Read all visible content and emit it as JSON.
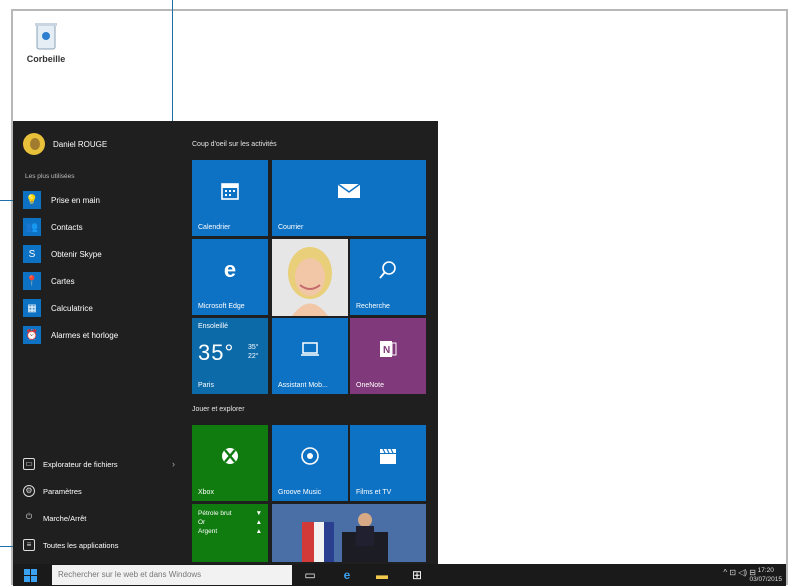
{
  "desktop": {
    "recycle_bin_label": "Corbeille"
  },
  "start_menu": {
    "user_name": "Daniel ROUGE",
    "most_used_label": "Les plus utilisées",
    "apps": [
      {
        "label": "Prise en main",
        "icon": "lightbulb-icon"
      },
      {
        "label": "Contacts",
        "icon": "people-icon"
      },
      {
        "label": "Obtenir Skype",
        "icon": "skype-icon"
      },
      {
        "label": "Cartes",
        "icon": "map-icon"
      },
      {
        "label": "Calculatrice",
        "icon": "calculator-icon"
      },
      {
        "label": "Alarmes et horloge",
        "icon": "alarm-clock-icon"
      }
    ],
    "bottom_items": [
      {
        "label": "Explorateur de fichiers",
        "icon": "folder-icon"
      },
      {
        "label": "Paramètres",
        "icon": "gear-icon"
      },
      {
        "label": "Marche/Arrêt",
        "icon": "power-icon"
      },
      {
        "label": "Toutes les applications",
        "icon": "list-icon"
      }
    ],
    "groups": {
      "activities": "Coup d'oeil sur les activités",
      "play": "Jouer et explorer"
    },
    "tiles": {
      "calendar": "Calendrier",
      "mail": "Courrier",
      "edge": "Microsoft Edge",
      "search": "Recherche",
      "weather_condition": "Ensoleillé",
      "weather_temp": "35°",
      "weather_high": "35°",
      "weather_low": "22°",
      "weather_city": "Paris",
      "connector": "Assistant Mob...",
      "onenote": "OneNote",
      "xbox": "Xbox",
      "groove": "Groove Music",
      "films": "Films et TV",
      "money_items": [
        "Pétrole brut",
        "Or",
        "Argent"
      ]
    }
  },
  "taskbar": {
    "search_placeholder": "Rechercher sur le web et dans Windows",
    "tray": "^ ⊡ ◁) ⊟",
    "time": "17:20",
    "date": "03/07/2015"
  },
  "colors": {
    "accent": "#0e72c4",
    "xbox_green": "#107c10",
    "onenote_purple": "#80397b",
    "menu_bg": "#1f1f1f",
    "callout": "#1f6fa8"
  }
}
